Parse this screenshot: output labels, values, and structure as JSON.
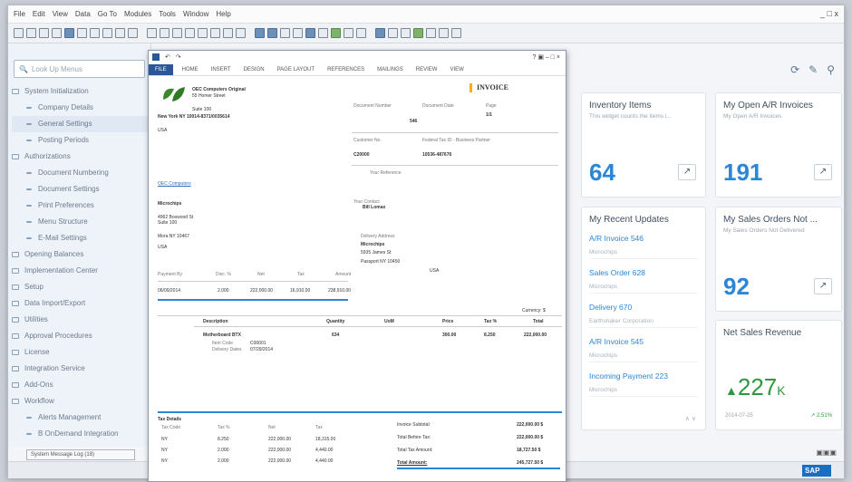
{
  "menu": [
    "File",
    "Edit",
    "View",
    "Data",
    "Go To",
    "Modules",
    "Tools",
    "Window",
    "Help"
  ],
  "window_controls": "_ □ x",
  "sidebar": {
    "search_placeholder": "Look Up Menus",
    "items": [
      {
        "label": "System Initialization",
        "sub": false
      },
      {
        "label": "Company Details",
        "sub": true
      },
      {
        "label": "General Settings",
        "sub": true,
        "selected": true
      },
      {
        "label": "Posting Periods",
        "sub": true
      },
      {
        "label": "Authorizations",
        "sub": false
      },
      {
        "label": "Document Numbering",
        "sub": true
      },
      {
        "label": "Document Settings",
        "sub": true
      },
      {
        "label": "Print Preferences",
        "sub": true
      },
      {
        "label": "Menu Structure",
        "sub": true
      },
      {
        "label": "E-Mail Settings",
        "sub": true
      },
      {
        "label": "Opening Balances",
        "sub": false
      },
      {
        "label": "Implementation Center",
        "sub": false
      },
      {
        "label": "Setup",
        "sub": false
      },
      {
        "label": "Data Import/Export",
        "sub": false
      },
      {
        "label": "Utilities",
        "sub": false
      },
      {
        "label": "Approval Procedures",
        "sub": false
      },
      {
        "label": "License",
        "sub": false
      },
      {
        "label": "Integration Service",
        "sub": false
      },
      {
        "label": "Add-Ons",
        "sub": false
      },
      {
        "label": "Workflow",
        "sub": false
      },
      {
        "label": "Alerts Management",
        "sub": true
      },
      {
        "label": "B OnDemand Integration",
        "sub": true
      }
    ],
    "message_tab": "System Message Log (18)"
  },
  "cockpit": {
    "inventory": {
      "title": "Inventory Items",
      "subtitle": "This widget counts the items i...",
      "value": "64"
    },
    "ar_invoices": {
      "title": "My Open A/R Invoices",
      "subtitle": "My Open A/R Invoices",
      "value": "191"
    },
    "recent": {
      "title": "My Recent Updates",
      "items": [
        {
          "label": "A/R Invoice 546",
          "sub": "Microchips"
        },
        {
          "label": "Sales Order 628",
          "sub": "Microchips"
        },
        {
          "label": "Delivery 670",
          "sub": "Earthshaker Corporation"
        },
        {
          "label": "A/R Invoice 545",
          "sub": "Microchips"
        },
        {
          "label": "Incoming Payment 223",
          "sub": "Microchips"
        }
      ]
    },
    "sales_orders": {
      "title": "My Sales Orders Not ...",
      "subtitle": "My Sales Orders Not Delivered",
      "value": "92"
    },
    "net_sales": {
      "title": "Net Sales Revenue",
      "value": "227",
      "unit": "K",
      "date": "2014-07-25",
      "change": "2.51%"
    }
  },
  "doc": {
    "tabs": [
      "FILE",
      "HOME",
      "INSERT",
      "DESIGN",
      "PAGE LAYOUT",
      "REFERENCES",
      "MAILINGS",
      "REVIEW",
      "VIEW"
    ],
    "winctl": "? ▣ – □ ×",
    "company": "OEC Computers Original",
    "company_addr": "55 Homer Street",
    "company_suite": "Suite 100",
    "company_city": "New York NY 10014-8371/0035614",
    "company_country": "USA",
    "invoice_title": "INVOICE",
    "h_docnum": "Document Number",
    "h_docdate": "Document Date",
    "h_page": "Page",
    "docnum": "546",
    "page": "1/1",
    "h_custno": "Customer No.",
    "h_fedtax": "Federal Tax ID - Business Partner",
    "custno": "C20000",
    "fedtax": "10536-487676",
    "your_ref": "Your Reference",
    "link": "OEC Computers",
    "cust_name": "Microchips",
    "cust_addr1": "4962 Boxwood St",
    "cust_addr2": "Suite 100",
    "cust_city": "Mora NY 10467",
    "cust_country": "USA",
    "contact_label": "Your Contact",
    "contact": "Bill Lomax",
    "delivery_label": "Delivery Address",
    "del_name": "Microchips",
    "del_addr": "5935 James St",
    "del_city": "Passport NY 10450",
    "del_country": "USA",
    "pay_h": [
      "Payment By",
      "Disc. %",
      "Net",
      "Tax",
      "Amount"
    ],
    "pay_v": [
      "06/09/2014",
      "2.000",
      "222,000.00",
      "16,910.00",
      "238,910.00"
    ],
    "currency": "Currency: $",
    "items_h": [
      "Description",
      "Quantity",
      "UoM",
      "Price",
      "Tax %",
      "Total"
    ],
    "item_desc": "Motherboard BTX",
    "item_qty": "634",
    "item_price": "300.00",
    "item_tax": "8.250",
    "item_total": "222,000.00",
    "item_itemcode": "Item Code",
    "item_itemcode_v": "C00001",
    "item_deliv": "Delivery Dates",
    "item_deliv_v": "07/29/2014",
    "tax_details": "Tax Details",
    "tax_h": [
      "Tax Code",
      "Tax %",
      "Net",
      "Tax"
    ],
    "tax_rows": [
      [
        "NY",
        "8.250",
        "222,000.00",
        "18,315.00"
      ],
      [
        "NY",
        "2.000",
        "222,000.00",
        "4,440.00"
      ],
      [
        "NY",
        "2.000",
        "222,000.00",
        "4,440.00"
      ]
    ],
    "sum": [
      {
        "label": "Invoice Subtotal:",
        "value": "222,000.00 $"
      },
      {
        "label": "Total Before Tax:",
        "value": "222,000.00 $"
      },
      {
        "label": "Total Tax Amount:",
        "value": "18,727.50 $"
      },
      {
        "label": "Total Amount:",
        "value": "245,727.50 $"
      }
    ]
  },
  "sap_logo": "SAP"
}
